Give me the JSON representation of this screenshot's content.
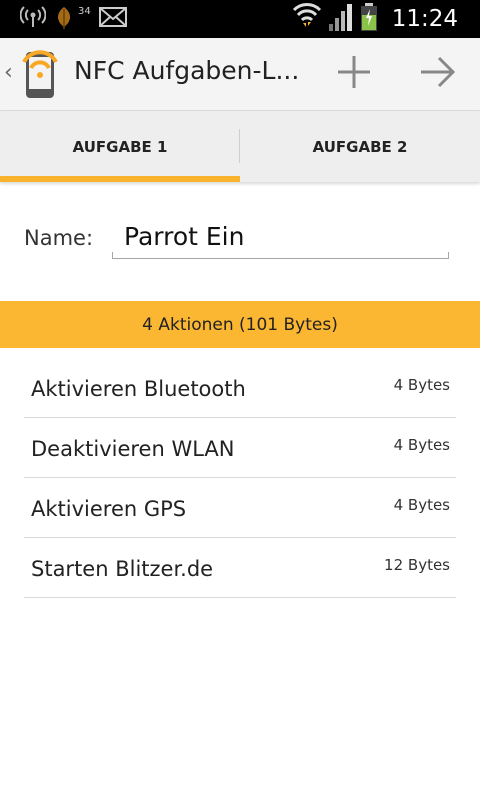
{
  "status_bar": {
    "signal_badge": "34",
    "time": "11:24",
    "icons": [
      "wireless-broadcast-icon",
      "leaf-icon",
      "mail-icon",
      "wifi-icon",
      "signal-bars-icon",
      "battery-charging-icon"
    ]
  },
  "action_bar": {
    "title": "NFC Aufgaben-L...",
    "icons": [
      "up-caret-icon",
      "nfc-phone-app-icon",
      "plus-icon",
      "arrow-right-icon"
    ]
  },
  "tabs": [
    {
      "label": "AUFGABE 1",
      "selected": true
    },
    {
      "label": "AUFGABE 2",
      "selected": false
    }
  ],
  "form": {
    "name_label": "Name:",
    "name_value": "Parrot Ein"
  },
  "summary": {
    "text": "4 Aktionen (101 Bytes)"
  },
  "actions": [
    {
      "name": "Aktivieren Bluetooth",
      "size": "4 Bytes"
    },
    {
      "name": "Deaktivieren WLAN",
      "size": "4 Bytes"
    },
    {
      "name": "Aktivieren GPS",
      "size": "4 Bytes"
    },
    {
      "name": "Starten Blitzer.de",
      "size": "12 Bytes"
    }
  ],
  "colors": {
    "accent": "#f9b22b",
    "banner": "#fbb731",
    "status_bar": "#000000",
    "action_bar": "#f4f4f4"
  }
}
